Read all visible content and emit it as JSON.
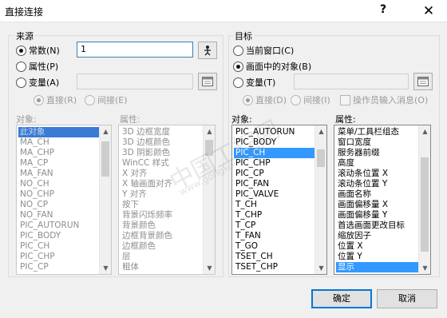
{
  "window": {
    "title": "直接连接",
    "help": "?",
    "close": "✕"
  },
  "source": {
    "group_label": "来源",
    "constant_label": "常数(N)",
    "property_label": "属性(P)",
    "variable_label": "变量(A)",
    "constant_value": "1",
    "direct_label": "直接(R)",
    "indirect_label": "间接(E)",
    "object_list_label": "对象:",
    "property_list_label": "属性:",
    "objects": [
      "此对象",
      "MA_CH",
      "MA_CHP",
      "MA_CP",
      "MA_FAN",
      "NO_CH",
      "NO_CHP",
      "NO_CP",
      "NO_FAN",
      "PIC_AUTORUN",
      "PIC_BODY",
      "PIC_CH",
      "PIC_CHP",
      "PIC_CP"
    ],
    "properties": [
      "3D 边框宽度",
      "3D 边框颜色",
      "3D 阴影颜色",
      "WinCC 样式",
      "X 对齐",
      "X 轴画面对齐",
      "Y 对齐",
      "按下",
      "背景闪烁频率",
      "背景颜色",
      "边框背景颜色",
      "边框颜色",
      "层",
      "粗体"
    ]
  },
  "target": {
    "group_label": "目标",
    "current_window_label": "当前窗口(C)",
    "object_in_picture_label": "画面中的对象(B)",
    "variable_label": "变量(T)",
    "direct_label": "直接(D)",
    "indirect_label": "间接(I)",
    "operator_message_label": "操作员输入消息(O)",
    "object_list_label": "对象:",
    "property_list_label": "属性:",
    "objects": [
      "PIC_AUTORUN",
      "PIC_BODY",
      "PIC_CH",
      "PIC_CHP",
      "PIC_CP",
      "PIC_FAN",
      "PIC_VALVE",
      "T_CH",
      "T_CHP",
      "T_CP",
      "T_FAN",
      "T_GO",
      "TSET_CH",
      "TSET_CHP"
    ],
    "properties": [
      "菜单/工具栏组态",
      "窗口宽度",
      "服务器前缀",
      "高度",
      "滚动条位置 X",
      "滚动条位置 Y",
      "画面名称",
      "画面偏移量 X",
      "画面偏移量 Y",
      "首选画面更改目标",
      "缩放因子",
      "位置 X",
      "位置 Y",
      "显示"
    ]
  },
  "buttons": {
    "ok": "确定",
    "cancel": "取消"
  },
  "watermark": {
    "main": "中国工控网",
    "sub": "www.gongkong.com"
  },
  "colors": {
    "selection": "#3399ff",
    "default_button_border": "#0078d7"
  }
}
